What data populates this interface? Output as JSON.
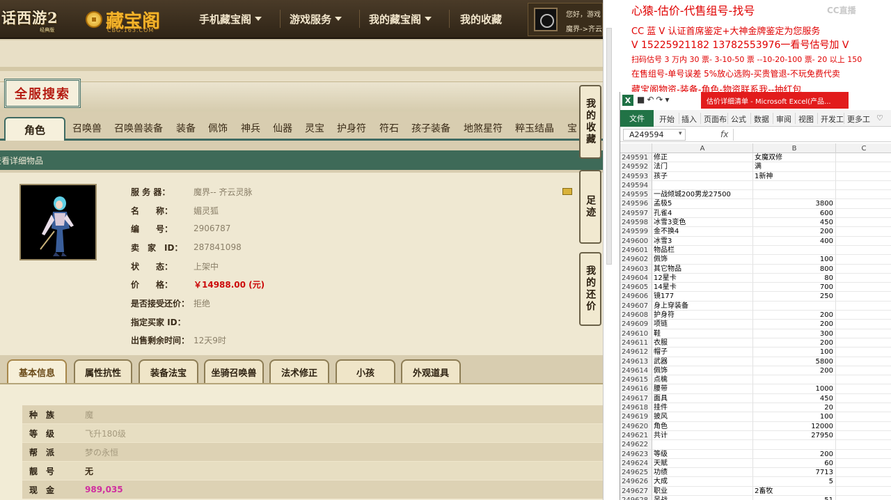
{
  "website": {
    "game_logo": "话西游2",
    "game_logo_sub": "经典版",
    "site_logo": "藏宝阁",
    "site_logo_sub": "CBG.163.COM",
    "nav": [
      {
        "label": "手机藏宝阁",
        "dropdown": true
      },
      {
        "label": "游戏服务",
        "dropdown": true
      },
      {
        "label": "我的藏宝阁",
        "dropdown": true
      },
      {
        "label": "我的收藏",
        "dropdown": false
      }
    ],
    "user": {
      "greeting": "您好，游戏",
      "server": "魔界->齐云"
    },
    "full_search_title": "全服搜索",
    "category_tabs": [
      "角色",
      "召唤兽",
      "召唤兽装备",
      "装备",
      "佩饰",
      "神兵",
      "仙器",
      "灵宝",
      "护身符",
      "符石",
      "孩子装备",
      "地煞星符",
      "粹玉结晶",
      "宝"
    ],
    "detail_header": "查看详细物品",
    "item": {
      "fields": [
        {
          "label": "服 务 器：",
          "value": "魔界-- 齐云灵脉"
        },
        {
          "label": "名　　称：",
          "value": "媚灵狐"
        },
        {
          "label": "编　　号：",
          "value": "2906787"
        },
        {
          "label": "卖　家　ID：",
          "value": "287841098"
        },
        {
          "label": "状　　态：",
          "value": "上架中"
        },
        {
          "label": "价　　格：",
          "value": "￥14988.00 (元)"
        },
        {
          "label": "是否接受还价：",
          "value": "拒绝"
        },
        {
          "label": "指定买家 ID：",
          "value": ""
        },
        {
          "label": "出售剩余时间：",
          "value": "12天9时"
        }
      ]
    },
    "side_buttons": [
      "我的收藏",
      "足迹",
      "我的还价"
    ],
    "info_tabs": [
      "基本信息",
      "属性抗性",
      "装备法宝",
      "坐骑召唤兽",
      "法术修正",
      "小孩",
      "外观道具"
    ],
    "attributes": [
      {
        "label": "种　族",
        "value": "魔",
        "style": "normal"
      },
      {
        "label": "等　级",
        "value": "飞升180级",
        "style": "normal"
      },
      {
        "label": "帮　派",
        "value": "梦の永恒",
        "style": "normal"
      },
      {
        "label": "靓　号",
        "value": "无",
        "style": "bold"
      },
      {
        "label": "现　金",
        "value": "989,035",
        "style": "pink"
      }
    ]
  },
  "notes": {
    "title": "心猿-估价-代售组号-找号",
    "lines": [
      "CC 蓝 V 认证首席鉴定+大神金牌鉴定为您服务",
      "V 15225921182      13782553976一看号估号加 V",
      "扫码估号 3 万内 30 票- 3-10-50 票  --10-20-100 票- 20 以上 150",
      "在售组号-单号误差 5%放心选购-买贵管退-不玩免费代卖",
      "藏宝阁物资-装备-角色-物资联系我--抽红包"
    ],
    "watermark": "CC直播"
  },
  "excel": {
    "title": "估价详细清单 - Microsoft Excel(产品...",
    "ribbon_file": "文件",
    "ribbon_tabs": [
      "开始",
      "插入",
      "页面布",
      "公式",
      "数据",
      "审阅",
      "视图",
      "开发工",
      "更多工"
    ],
    "name_box": "A249594",
    "fx": "fx",
    "columns": [
      "A",
      "B",
      "C"
    ],
    "rows": [
      {
        "n": "249591",
        "a": "修正",
        "b": "女魔双修",
        "t": "txt"
      },
      {
        "n": "249592",
        "a": "法门",
        "b": "满",
        "t": "txt"
      },
      {
        "n": "249593",
        "a": "孩子",
        "b": "1新神",
        "t": "txt"
      },
      {
        "n": "249594",
        "a": "",
        "b": "",
        "t": "txt"
      },
      {
        "n": "249595",
        "a": "一战倾城200男龙27500",
        "b": "",
        "t": "txt"
      },
      {
        "n": "249596",
        "a": "孟极5",
        "b": "3800",
        "t": "num"
      },
      {
        "n": "249597",
        "a": "孔雀4",
        "b": "600",
        "t": "num"
      },
      {
        "n": "249598",
        "a": "冰雪3变色",
        "b": "450",
        "t": "num"
      },
      {
        "n": "249599",
        "a": "金不换4",
        "b": "200",
        "t": "num"
      },
      {
        "n": "249600",
        "a": "冰雪3",
        "b": "400",
        "t": "num"
      },
      {
        "n": "249601",
        "a": "物品栏",
        "b": "",
        "t": "txt"
      },
      {
        "n": "249602",
        "a": "佩饰",
        "b": "100",
        "t": "num"
      },
      {
        "n": "249603",
        "a": "其它物品",
        "b": "800",
        "t": "num"
      },
      {
        "n": "249604",
        "a": "12星卡",
        "b": "80",
        "t": "num"
      },
      {
        "n": "249605",
        "a": "14星卡",
        "b": "700",
        "t": "num"
      },
      {
        "n": "249606",
        "a": "镜177",
        "b": "250",
        "t": "num"
      },
      {
        "n": "249607",
        "a": "身上穿装备",
        "b": "",
        "t": "txt"
      },
      {
        "n": "249608",
        "a": "护身符",
        "b": "200",
        "t": "num"
      },
      {
        "n": "249609",
        "a": "项链",
        "b": "200",
        "t": "num"
      },
      {
        "n": "249610",
        "a": "鞋",
        "b": "300",
        "t": "num"
      },
      {
        "n": "249611",
        "a": "衣服",
        "b": "200",
        "t": "num"
      },
      {
        "n": "249612",
        "a": "帽子",
        "b": "100",
        "t": "num"
      },
      {
        "n": "249613",
        "a": "武器",
        "b": "5800",
        "t": "num"
      },
      {
        "n": "249614",
        "a": "佩饰",
        "b": "200",
        "t": "num"
      },
      {
        "n": "249615",
        "a": "点檎",
        "b": "",
        "t": "txt"
      },
      {
        "n": "249616",
        "a": "腰带",
        "b": "1000",
        "t": "num"
      },
      {
        "n": "249617",
        "a": "面具",
        "b": "450",
        "t": "num"
      },
      {
        "n": "249618",
        "a": "挂件",
        "b": "20",
        "t": "num"
      },
      {
        "n": "249619",
        "a": "披风",
        "b": "100",
        "t": "num"
      },
      {
        "n": "249620",
        "a": "角色",
        "b": "12000",
        "t": "num"
      },
      {
        "n": "249621",
        "a": "共计",
        "b": "27950",
        "t": "num"
      },
      {
        "n": "249622",
        "a": "",
        "b": "",
        "t": "txt"
      },
      {
        "n": "249623",
        "a": "等级",
        "b": "200",
        "t": "num"
      },
      {
        "n": "249624",
        "a": "天赋",
        "b": "60",
        "t": "num"
      },
      {
        "n": "249625",
        "a": "功绩",
        "b": "7713",
        "t": "num"
      },
      {
        "n": "249626",
        "a": "大成",
        "b": "5",
        "t": "num"
      },
      {
        "n": "249627",
        "a": "职业",
        "b": "2畜牧",
        "t": "txt"
      },
      {
        "n": "249628",
        "a": "呆战",
        "b": "51",
        "t": "num"
      }
    ]
  }
}
